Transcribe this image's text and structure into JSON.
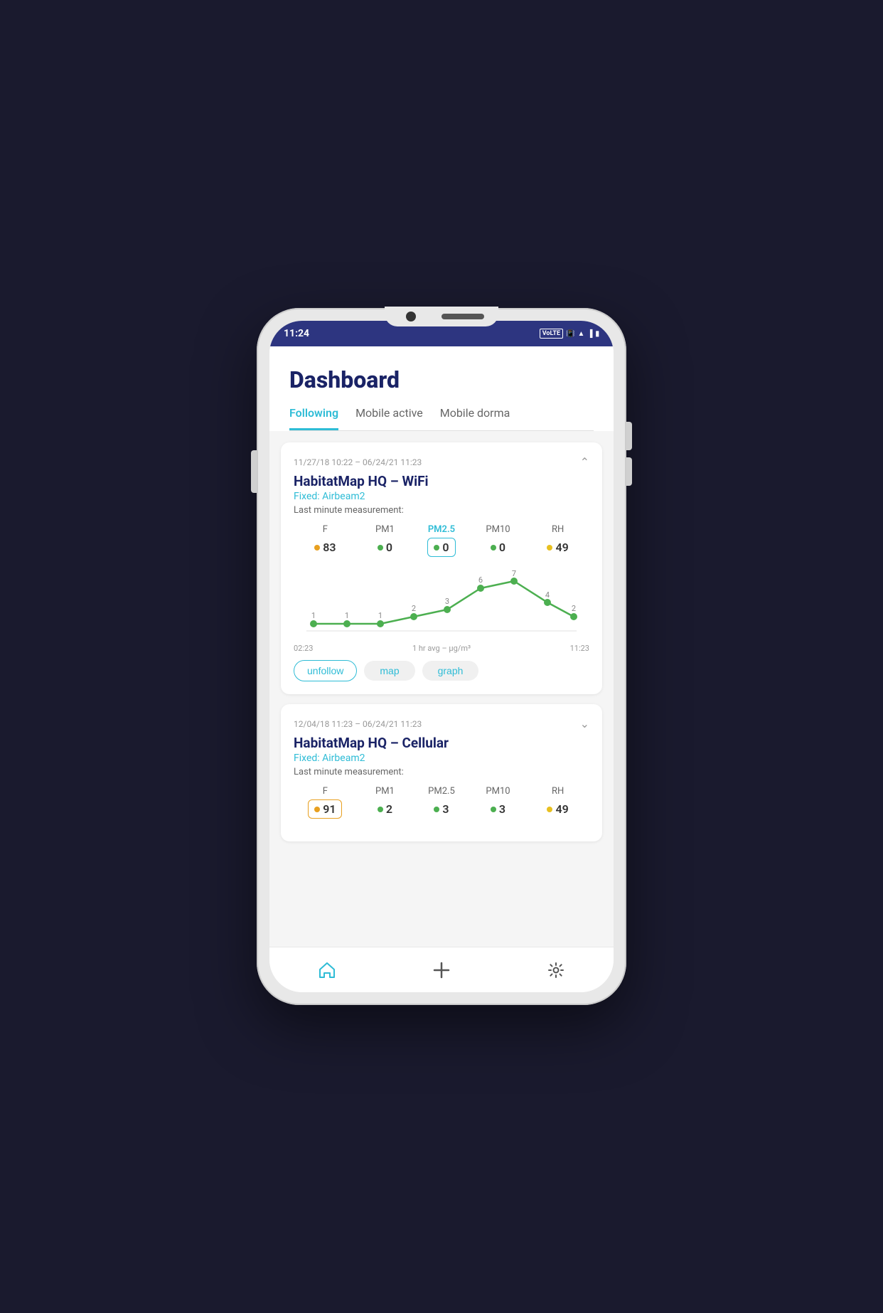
{
  "status_bar": {
    "time": "11:24",
    "badge": "VoLTE"
  },
  "header": {
    "title": "Dashboard"
  },
  "tabs": [
    {
      "label": "Following",
      "active": true
    },
    {
      "label": "Mobile active",
      "active": false
    },
    {
      "label": "Mobile dorma",
      "active": false
    }
  ],
  "cards": [
    {
      "id": "card1",
      "date_range": "11/27/18 10:22 – 06/24/21 11:23",
      "title": "HabitatMap HQ – WiFi",
      "subtitle": "Fixed: Airbeam2",
      "measurement_label": "Last minute measurement:",
      "expanded": true,
      "measurements": [
        {
          "label": "F",
          "value": "83",
          "dot_color": "#e8a020",
          "selected": false
        },
        {
          "label": "PM1",
          "value": "0",
          "dot_color": "#4caf50",
          "selected": false
        },
        {
          "label": "PM2.5",
          "value": "0",
          "dot_color": "#4caf50",
          "selected": true
        },
        {
          "label": "PM10",
          "value": "0",
          "dot_color": "#4caf50",
          "selected": false
        },
        {
          "label": "RH",
          "value": "49",
          "dot_color": "#e8c020",
          "selected": false
        }
      ],
      "chart": {
        "points": [
          {
            "x": 0,
            "y": 1,
            "label": "1"
          },
          {
            "x": 1,
            "y": 1,
            "label": "1"
          },
          {
            "x": 2,
            "y": 1,
            "label": "1"
          },
          {
            "x": 3,
            "y": 2,
            "label": "2"
          },
          {
            "x": 4,
            "y": 3,
            "label": "3"
          },
          {
            "x": 5,
            "y": 6,
            "label": "6"
          },
          {
            "x": 6,
            "y": 7,
            "label": "7"
          },
          {
            "x": 7,
            "y": 4,
            "label": "4"
          },
          {
            "x": 8,
            "y": 2,
            "label": "2"
          }
        ],
        "time_start": "02:23",
        "time_unit": "1 hr avg – μg/m³",
        "time_end": "11:23"
      },
      "actions": [
        {
          "label": "unfollow",
          "type": "outline"
        },
        {
          "label": "map",
          "type": "fill"
        },
        {
          "label": "graph",
          "type": "fill"
        }
      ]
    },
    {
      "id": "card2",
      "date_range": "12/04/18 11:23 – 06/24/21 11:23",
      "title": "HabitatMap HQ – Cellular",
      "subtitle": "Fixed: Airbeam2",
      "measurement_label": "Last minute measurement:",
      "expanded": false,
      "measurements": [
        {
          "label": "F",
          "value": "91",
          "dot_color": "#e8a020",
          "selected": true
        },
        {
          "label": "PM1",
          "value": "2",
          "dot_color": "#4caf50",
          "selected": false
        },
        {
          "label": "PM2.5",
          "value": "3",
          "dot_color": "#4caf50",
          "selected": false
        },
        {
          "label": "PM10",
          "value": "3",
          "dot_color": "#4caf50",
          "selected": false
        },
        {
          "label": "RH",
          "value": "49",
          "dot_color": "#e8c020",
          "selected": false
        }
      ],
      "actions": []
    }
  ],
  "bottom_nav": [
    {
      "label": "home",
      "icon": "home",
      "active": true
    },
    {
      "label": "add",
      "icon": "plus",
      "active": false
    },
    {
      "label": "settings",
      "icon": "gear",
      "active": false
    }
  ]
}
